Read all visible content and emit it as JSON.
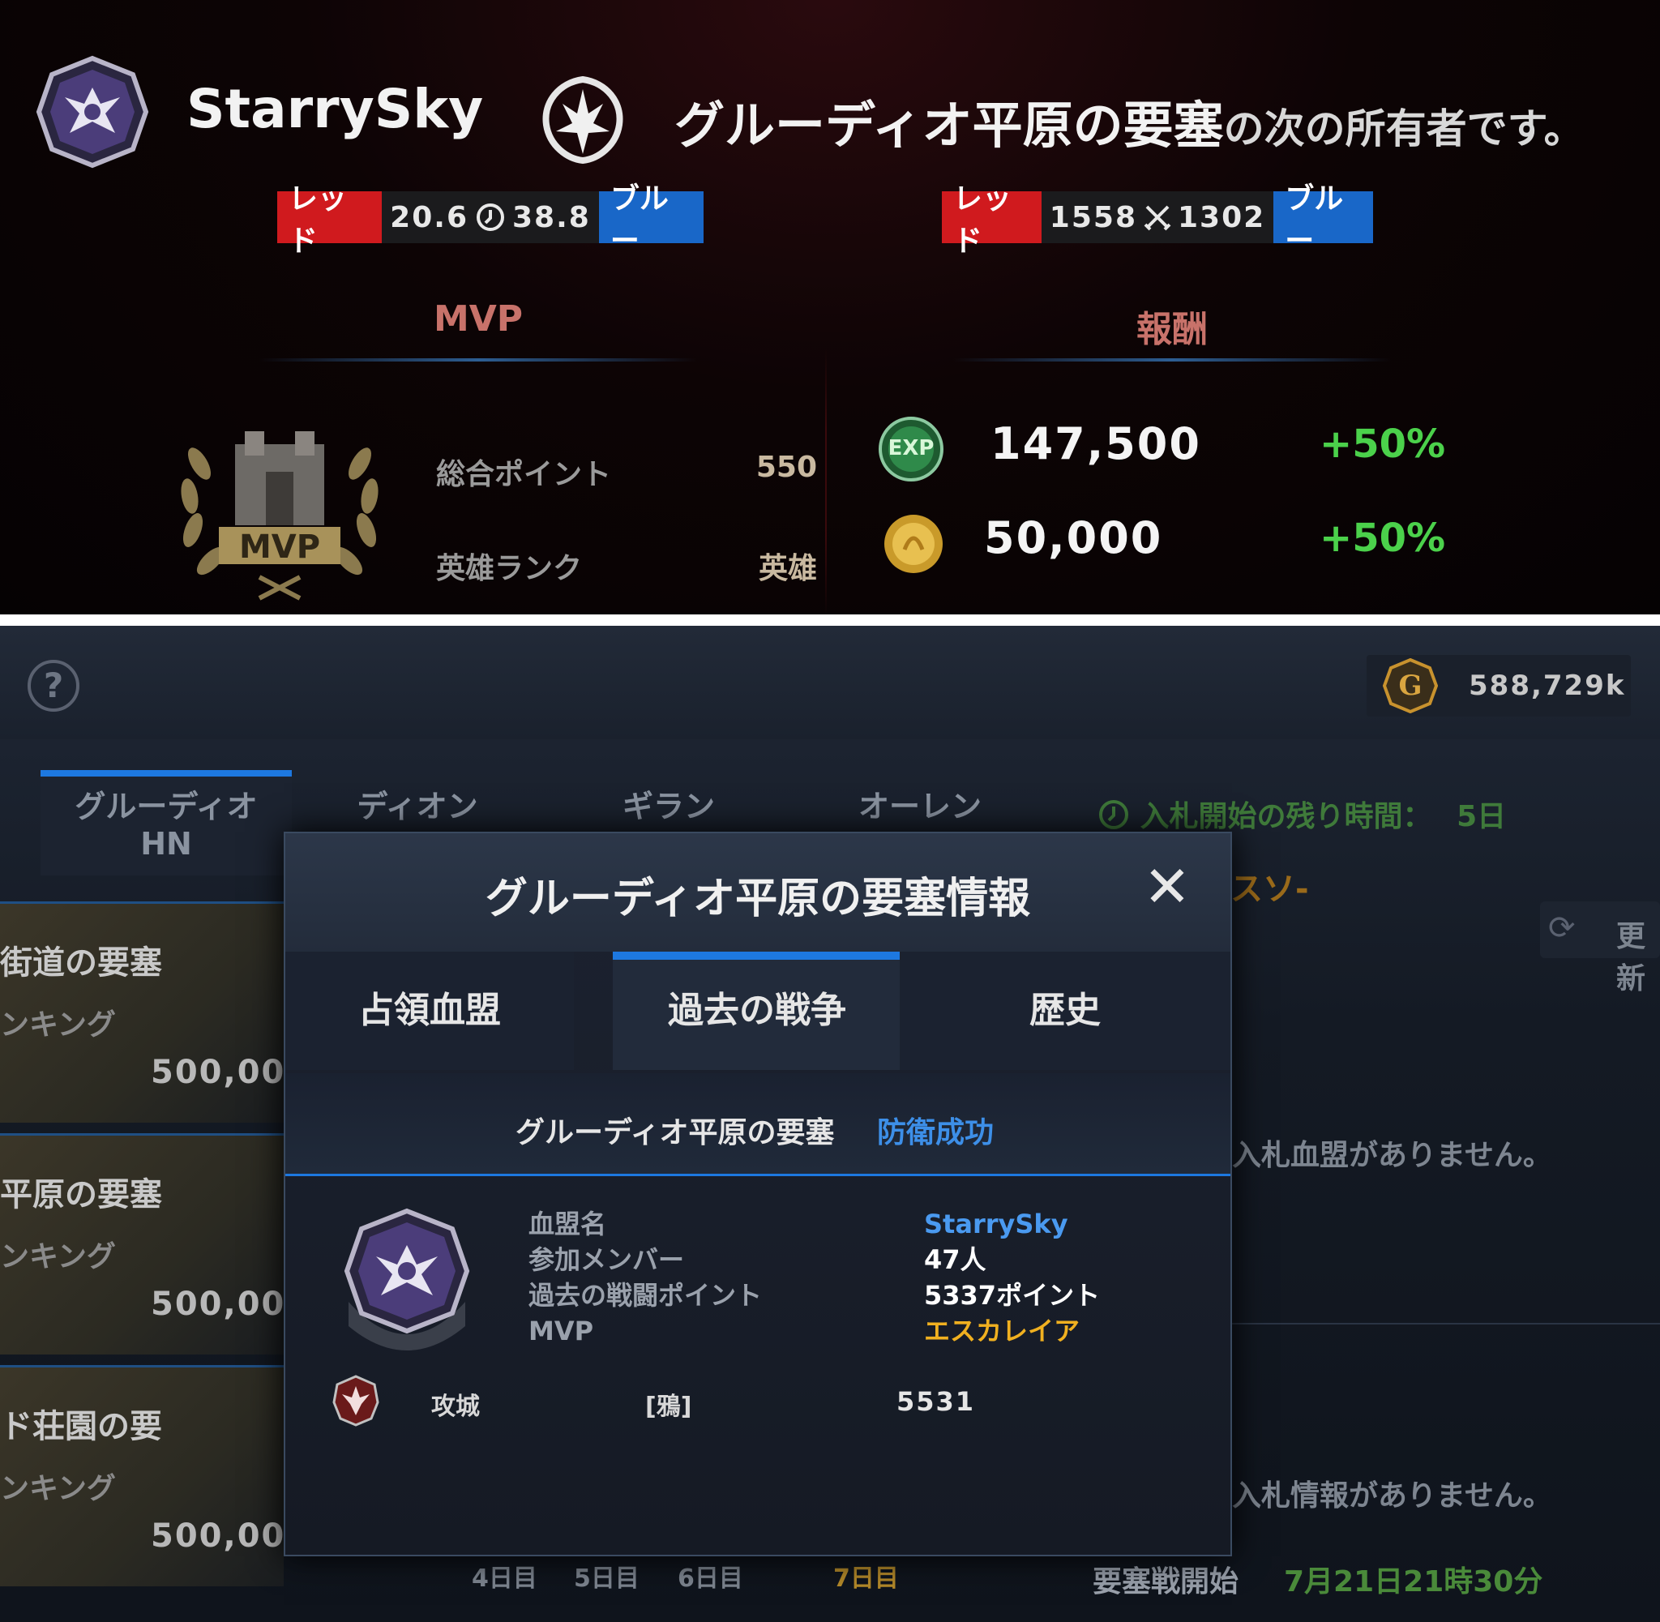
{
  "result": {
    "clan_name": "StarrySky",
    "fortress_name": "グルーディオ平原の要塞",
    "owner_suffix": "の次の所有者です。",
    "time_pill": {
      "left": "レッド",
      "left_value": "20.6",
      "right_value": "38.8",
      "right": "ブルー",
      "icon": "clock-icon"
    },
    "kill_pill": {
      "left": "レッド",
      "left_value": "1558",
      "right_value": "1302",
      "right": "ブルー",
      "icon": "crossed-swords-icon"
    },
    "mvp_section": {
      "heading": "MVP",
      "badge_text": "MVP",
      "rows": [
        {
          "label": "総合ポイント",
          "value": "550"
        },
        {
          "label": "英雄ランク",
          "value": "英雄"
        }
      ]
    },
    "reward_section": {
      "heading": "報酬",
      "rows": [
        {
          "icon": "exp-icon",
          "icon_text": "EXP",
          "value": "147,500",
          "bonus": "+50%"
        },
        {
          "icon": "gold-coin-icon",
          "value": "50,000",
          "bonus": "+50%"
        }
      ]
    }
  },
  "siege": {
    "help_icon": "?",
    "currency": {
      "icon": "g-coin-icon",
      "icon_text": "G",
      "amount": "588,729k"
    },
    "tabs": [
      {
        "label": "グルーディオ",
        "sub": "HN"
      },
      {
        "label": "ディオン",
        "sub": ""
      },
      {
        "label": "ギラン",
        "sub": ""
      },
      {
        "label": "オーレン",
        "sub": ""
      }
    ],
    "bid_timer": {
      "label": "入札開始の残り時間：",
      "value": "5日"
    },
    "side_clan": "スソ-",
    "refresh_label": "更新",
    "fortress_list": [
      {
        "name": "街道の要塞",
        "rank": "ンキング",
        "points": "500,00"
      },
      {
        "name": "平原の要塞",
        "rank": "ンキング",
        "points": "500,00"
      },
      {
        "name": "ド荘園の要",
        "rank": "ンキング",
        "points": "500,00"
      }
    ],
    "right_notes": [
      "入札血盟がありません。",
      "入札情報がありません。"
    ],
    "days": [
      "4日目",
      "5日目",
      "6日目",
      "7日目"
    ],
    "start": {
      "label": "要塞戦開始",
      "value": "7月21日21時30分"
    }
  },
  "modal": {
    "title": "グルーディオ平原の要塞情報",
    "close": "✕",
    "tabs": [
      "占領血盟",
      "過去の戦争",
      "歴史"
    ],
    "active_tab": 1,
    "result_fortress": "グルーディオ平原の要塞",
    "result_status": "防衛成功",
    "info": [
      {
        "label": "血盟名",
        "value": "StarrySky",
        "color": "#4a9af0"
      },
      {
        "label": "参加メンバー",
        "value": "47人",
        "color": "#ffffff"
      },
      {
        "label": "過去の戦闘ポイント",
        "value": "5337ポイント",
        "color": "#ffffff"
      },
      {
        "label": "MVP",
        "value": "エスカレイア",
        "color": "#f0b020"
      }
    ],
    "attacker": {
      "role": "攻城",
      "clan": "[鴉]",
      "points": "5531"
    }
  },
  "colors": {
    "red": "#d01a1e",
    "blue": "#1967c8",
    "green": "#4bd14b",
    "link": "#4a9af0",
    "mvp_gold": "#f0b020",
    "accent": "#1d78e0"
  }
}
